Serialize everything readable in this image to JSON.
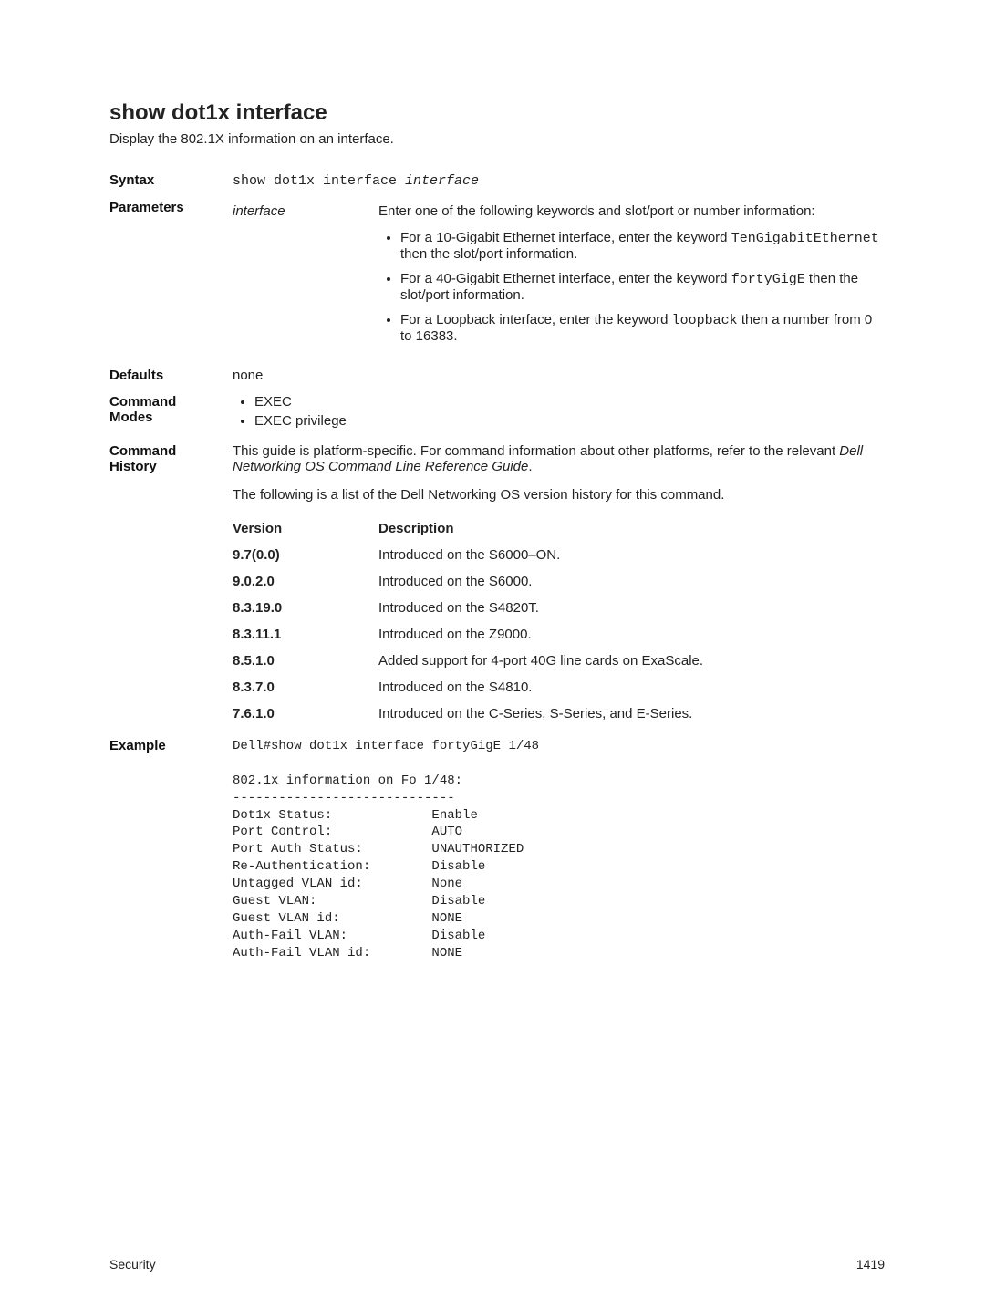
{
  "title": "show dot1x interface",
  "intro": "Display the 802.1X information on an interface.",
  "syntax": {
    "label": "Syntax",
    "code": "show dot1x interface ",
    "arg": "interface"
  },
  "parameters": {
    "label": "Parameters",
    "name": "interface",
    "desc_lead": "Enter one of the following keywords and slot/port or number information:",
    "bullets": {
      "b1_a": "For a 10-Gigabit Ethernet interface, enter the keyword ",
      "b1_code": "TenGigabitEthernet",
      "b1_b": " then the slot/port information.",
      "b2_a": "For a 40-Gigabit Ethernet interface, enter the keyword ",
      "b2_code": "fortyGigE",
      "b2_b": " then the slot/port information.",
      "b3_a": "For a Loopback interface, enter the keyword ",
      "b3_code": "loopback",
      "b3_b": " then a number from 0 to 16383."
    }
  },
  "defaults": {
    "label": "Defaults",
    "value": "none"
  },
  "modes": {
    "label": "Command Modes",
    "items": {
      "i1": "EXEC",
      "i2": "EXEC privilege"
    }
  },
  "history": {
    "label": "Command History",
    "para1_a": "This guide is platform-specific. For command information about other platforms, refer to the relevant ",
    "para1_i": "Dell Networking OS Command Line Reference Guide",
    "para1_b": ".",
    "para2": "The following is a list of the Dell Networking OS version history for this command.",
    "head_v": "Version",
    "head_d": "Description",
    "rows": [
      {
        "v": "9.7(0.0)",
        "d": "Introduced on the S6000–ON."
      },
      {
        "v": "9.0.2.0",
        "d": "Introduced on the S6000."
      },
      {
        "v": "8.3.19.0",
        "d": "Introduced on the S4820T."
      },
      {
        "v": "8.3.11.1",
        "d": "Introduced on the Z9000."
      },
      {
        "v": "8.5.1.0",
        "d": "Added support for 4-port 40G line cards on ExaScale."
      },
      {
        "v": "8.3.7.0",
        "d": "Introduced on the S4810."
      },
      {
        "v": "7.6.1.0",
        "d": "Introduced on the C-Series, S-Series, and E-Series."
      }
    ]
  },
  "example": {
    "label": "Example",
    "text": "Dell#show dot1x interface fortyGigE 1/48\n\n802.1x information on Fo 1/48:\n-----------------------------\nDot1x Status:             Enable\nPort Control:             AUTO\nPort Auth Status:         UNAUTHORIZED\nRe-Authentication:        Disable\nUntagged VLAN id:         None\nGuest VLAN:               Disable\nGuest VLAN id:            NONE\nAuth-Fail VLAN:           Disable\nAuth-Fail VLAN id:        NONE"
  },
  "footer": {
    "left": "Security",
    "right": "1419"
  }
}
